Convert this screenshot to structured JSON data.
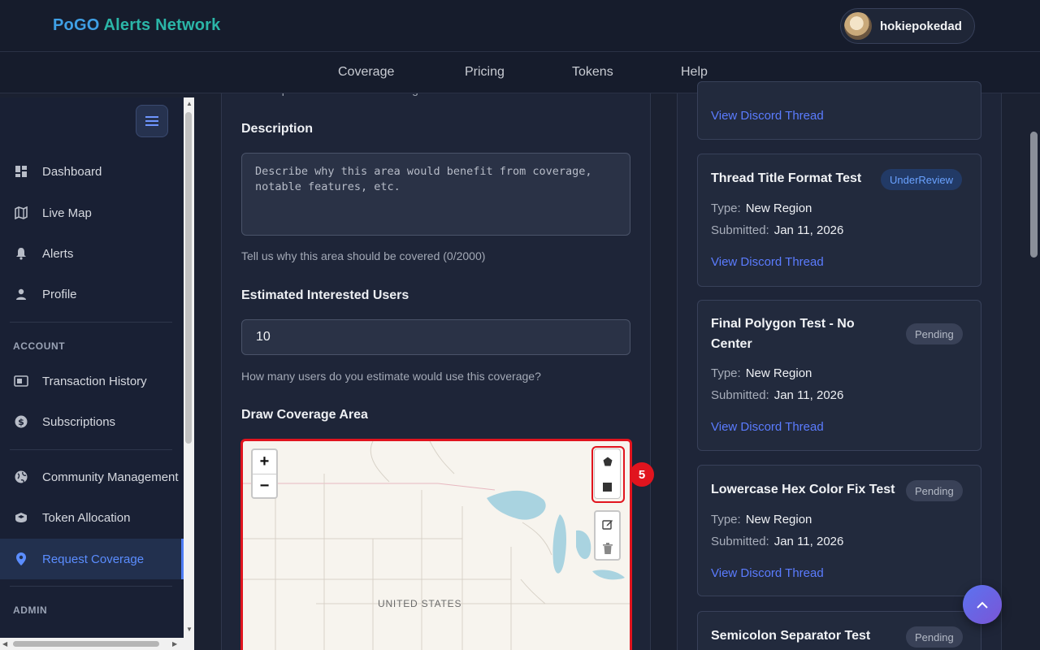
{
  "brand": {
    "part1": "PoGO ",
    "part2": "Alerts Network"
  },
  "user": {
    "name": "hokiepokedad"
  },
  "nav": {
    "coverage": "Coverage",
    "pricing": "Pricing",
    "tokens": "Tokens",
    "help": "Help"
  },
  "sidebar": {
    "items": [
      {
        "label": "Dashboard",
        "icon": "dashboard-icon"
      },
      {
        "label": "Live Map",
        "icon": "map-icon"
      },
      {
        "label": "Alerts",
        "icon": "bell-icon"
      },
      {
        "label": "Profile",
        "icon": "person-icon"
      }
    ],
    "account_section": "ACCOUNT",
    "account_items": [
      {
        "label": "Transaction History",
        "icon": "receipt-icon"
      },
      {
        "label": "Subscriptions",
        "icon": "dollar-icon"
      }
    ],
    "community_items": [
      {
        "label": "Community Management",
        "icon": "globe-icon"
      },
      {
        "label": "Token Allocation",
        "icon": "shield-icon"
      },
      {
        "label": "Request Coverage",
        "icon": "location-pin-icon"
      }
    ],
    "admin_section": "ADMIN"
  },
  "form": {
    "name_hint": "A descriptive name for this coverage area",
    "description_label": "Description",
    "description_placeholder": "Describe why this area would benefit from coverage, notable features, etc.",
    "description_hint": "Tell us why this area should be covered (0/2000)",
    "users_label": "Estimated Interested Users",
    "users_value": "10",
    "users_hint": "How many users do you estimate would use this coverage?",
    "map_label": "Draw Coverage Area",
    "map_country": "UNITED STATES",
    "zoom_in": "+",
    "zoom_out": "−",
    "annotation_badge": "5"
  },
  "requests": [
    {
      "title": "",
      "type_label": "",
      "type": "",
      "submitted_label": "",
      "submitted": "",
      "link": "View Discord Thread",
      "status": ""
    },
    {
      "title": "Thread Title Format Test",
      "type_label": "Type:",
      "type": "New Region",
      "submitted_label": "Submitted:",
      "submitted": "Jan 11, 2026",
      "link": "View Discord Thread",
      "status": "UnderReview"
    },
    {
      "title": "Final Polygon Test - No Center",
      "type_label": "Type:",
      "type": "New Region",
      "submitted_label": "Submitted:",
      "submitted": "Jan 11, 2026",
      "link": "View Discord Thread",
      "status": "Pending"
    },
    {
      "title": "Lowercase Hex Color Fix Test",
      "type_label": "Type:",
      "type": "New Region",
      "submitted_label": "Submitted:",
      "submitted": "Jan 11, 2026",
      "link": "View Discord Thread",
      "status": "Pending"
    },
    {
      "title": "Semicolon Separator Test",
      "status": "Pending"
    }
  ],
  "colors": {
    "accent": "#5b7cff",
    "highlight": "#e1141e",
    "background": "#1b2131"
  }
}
